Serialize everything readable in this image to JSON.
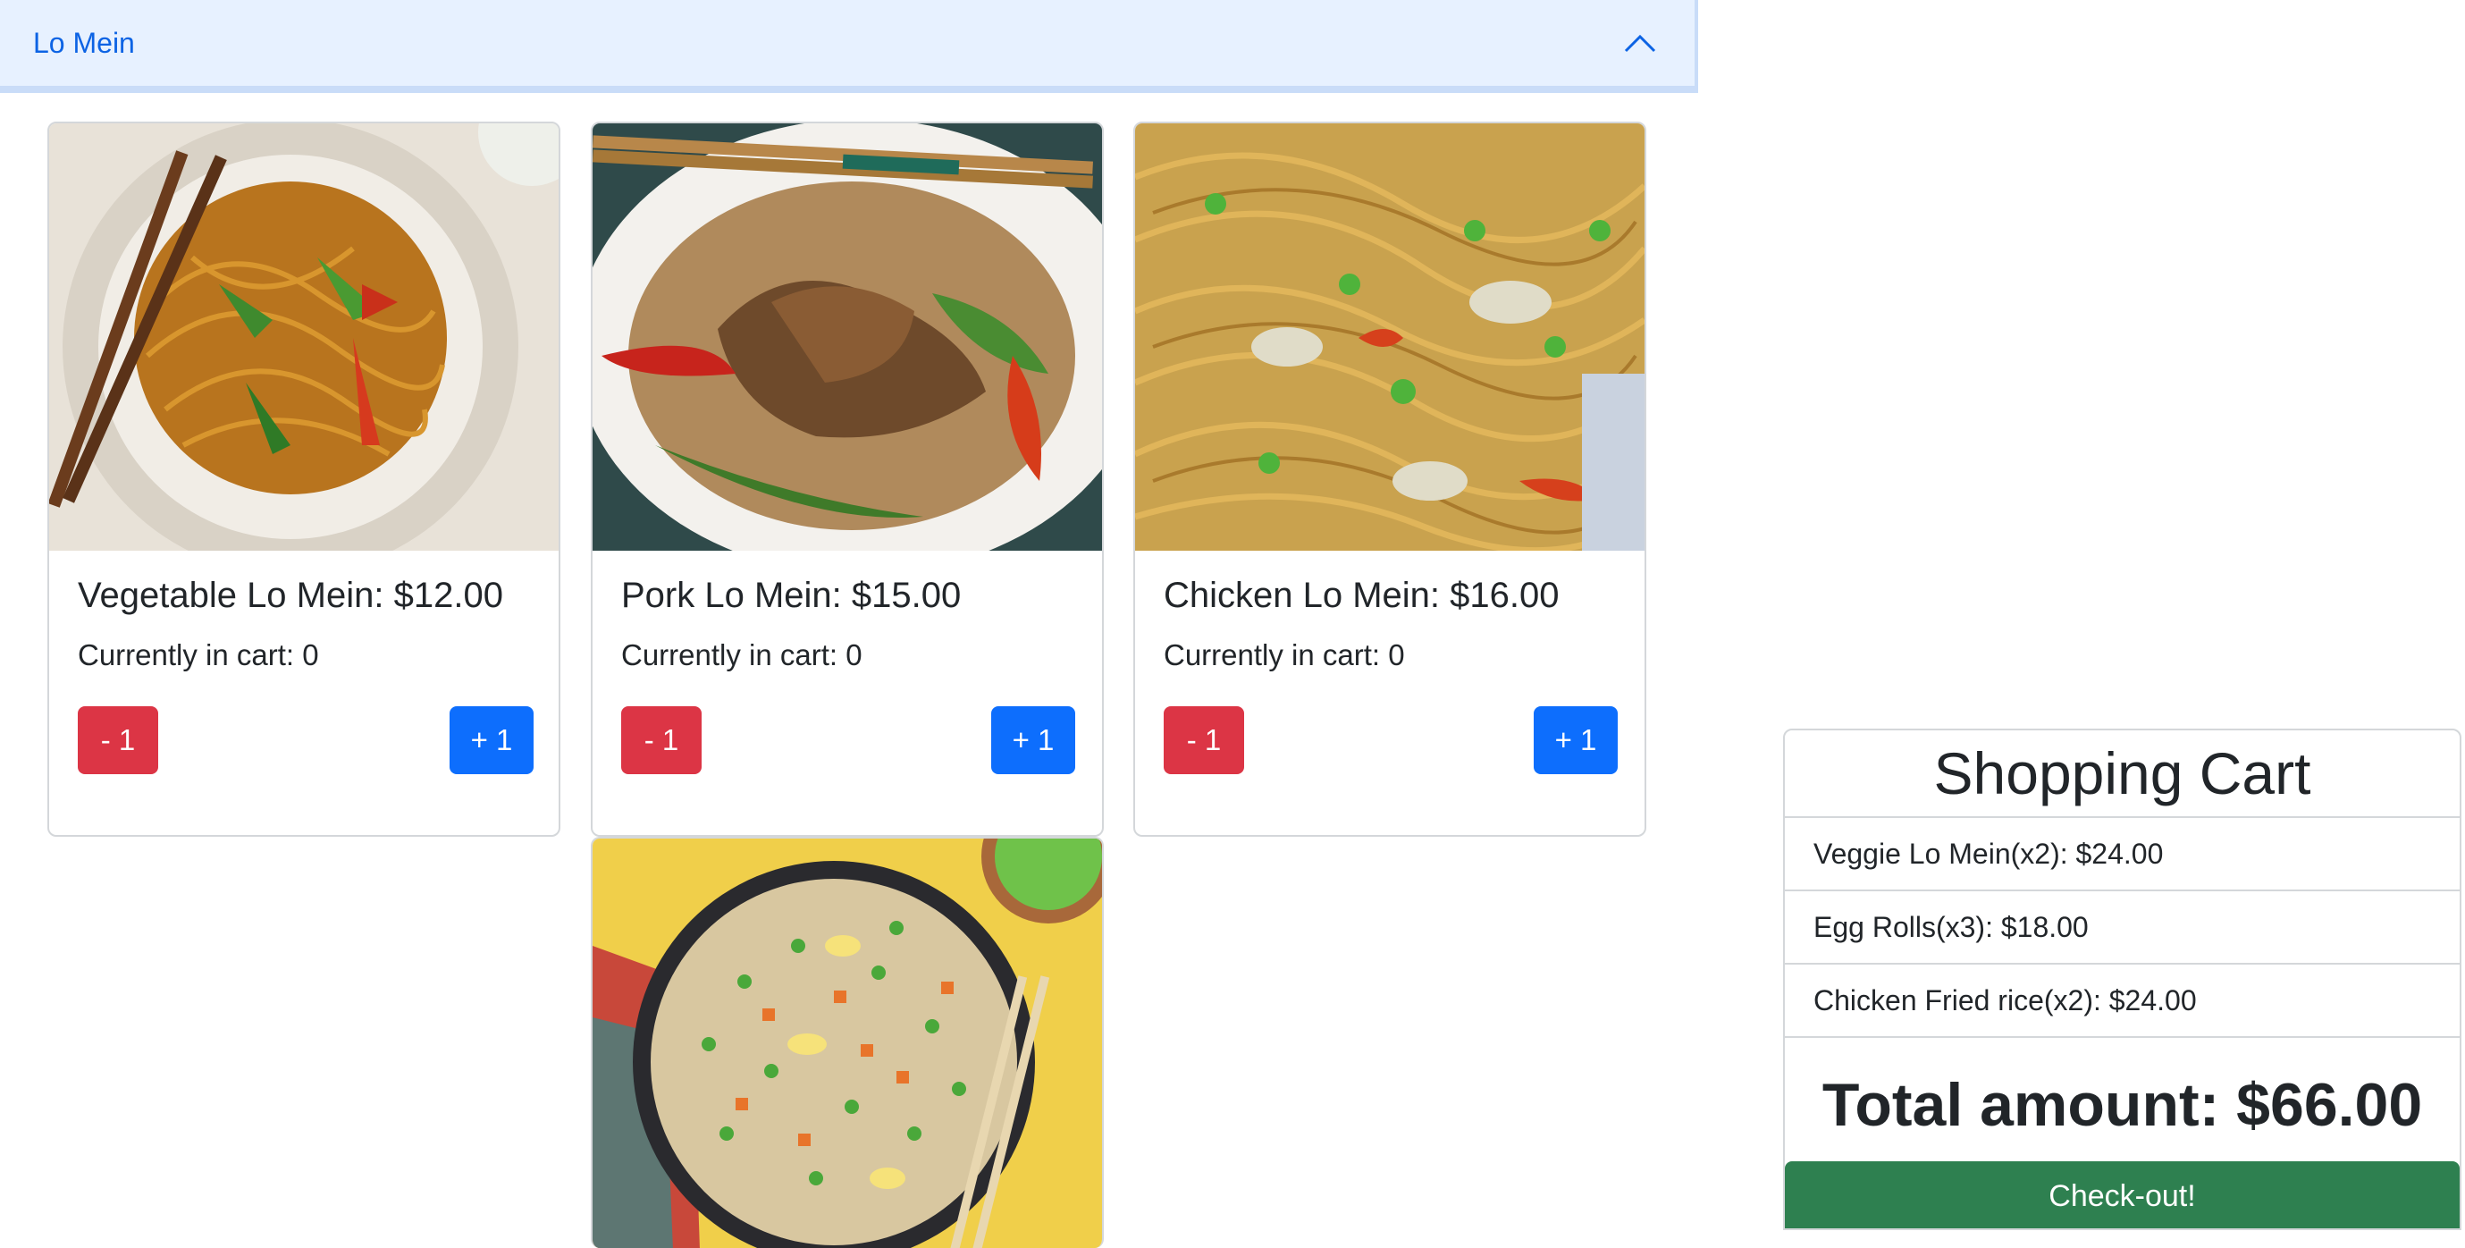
{
  "accordion": {
    "title": "Lo Mein",
    "chevron_icon": "chevron-up-icon",
    "accent": "#0c63e4",
    "background": "#e7f1ff"
  },
  "cards": [
    {
      "title": "Vegetable Lo Mein: $12.00",
      "count": "Currently in cart: 0",
      "minus": "- 1",
      "plus": "+ 1",
      "image": "vegetable-lo-mein-photo"
    },
    {
      "title": "Pork Lo Mein: $15.00",
      "count": "Currently in cart: 0",
      "minus": "- 1",
      "plus": "+ 1",
      "image": "pork-lo-mein-photo"
    },
    {
      "title": "Chicken Lo Mein: $16.00",
      "count": "Currently in cart: 0",
      "minus": "- 1",
      "plus": "+ 1",
      "image": "chicken-lo-mein-photo"
    },
    {
      "image": "fried-rice-photo"
    }
  ],
  "cart": {
    "title": "Shopping Cart",
    "items": [
      "Veggie Lo Mein(x2): $24.00",
      "Egg Rolls(x3): $18.00",
      "Chicken Fried rice(x2): $24.00"
    ],
    "total": "Total amount: $66.00",
    "checkout": "Check-out!"
  },
  "colors": {
    "minus_button": "#dc3545",
    "plus_button": "#0d6efd",
    "checkout_button": "#2e8050"
  }
}
